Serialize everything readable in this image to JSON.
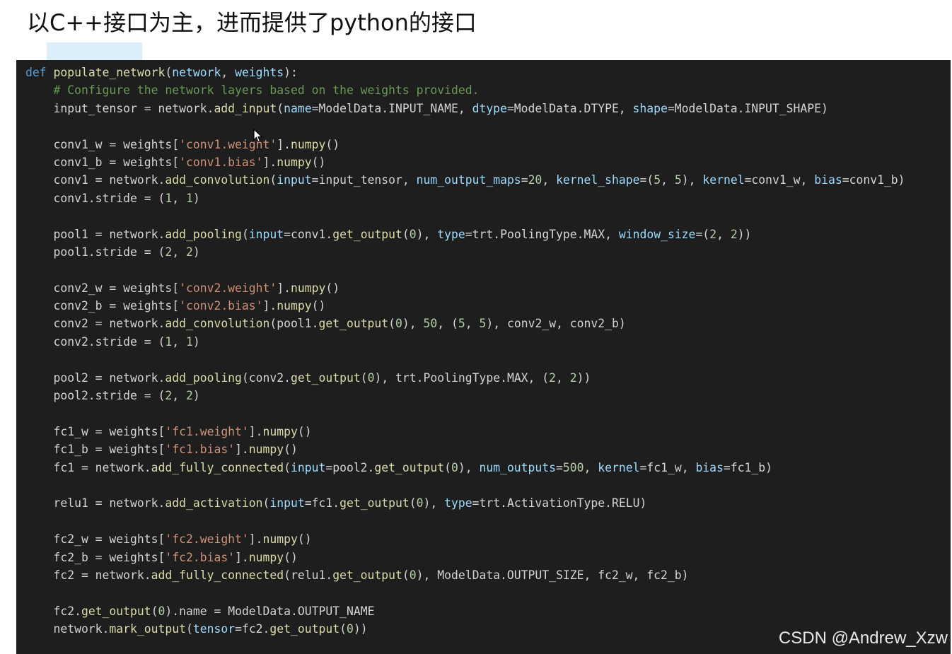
{
  "heading": {
    "text": "以C++接口为主，进而提供了python的接口"
  },
  "editor": {
    "colors": {
      "background": "#1e1e1e",
      "keyword": "#569cd6",
      "function": "#dcdcaa",
      "parameter": "#9cdcfe",
      "comment": "#6a9955",
      "string": "#ce9178",
      "number": "#b5cea8",
      "plain": "#d4d4d4"
    },
    "lines": [
      [
        [
          "kw",
          "def"
        ],
        [
          "pl",
          " "
        ],
        [
          "fn",
          "populate_network"
        ],
        [
          "pl",
          "("
        ],
        [
          "param",
          "network"
        ],
        [
          "pl",
          ", "
        ],
        [
          "param",
          "weights"
        ],
        [
          "pl",
          "):"
        ]
      ],
      [
        [
          "pl",
          "    "
        ],
        [
          "cm",
          "# Configure the network layers based on the weights provided."
        ]
      ],
      [
        [
          "pl",
          "    input_tensor = network."
        ],
        [
          "fn",
          "add_input"
        ],
        [
          "pl",
          "("
        ],
        [
          "param",
          "name"
        ],
        [
          "pl",
          "=ModelData.INPUT_NAME, "
        ],
        [
          "param",
          "dtype"
        ],
        [
          "pl",
          "=ModelData.DTYPE, "
        ],
        [
          "param",
          "shape"
        ],
        [
          "pl",
          "=ModelData.INPUT_SHAPE)"
        ]
      ],
      [],
      [
        [
          "pl",
          "    conv1_w = weights["
        ],
        [
          "str",
          "'conv1.weight'"
        ],
        [
          "pl",
          "]."
        ],
        [
          "fn",
          "numpy"
        ],
        [
          "pl",
          "()"
        ]
      ],
      [
        [
          "pl",
          "    conv1_b = weights["
        ],
        [
          "str",
          "'conv1.bias'"
        ],
        [
          "pl",
          "]."
        ],
        [
          "fn",
          "numpy"
        ],
        [
          "pl",
          "()"
        ]
      ],
      [
        [
          "pl",
          "    conv1 = network."
        ],
        [
          "fn",
          "add_convolution"
        ],
        [
          "pl",
          "("
        ],
        [
          "param",
          "input"
        ],
        [
          "pl",
          "=input_tensor, "
        ],
        [
          "param",
          "num_output_maps"
        ],
        [
          "pl",
          "="
        ],
        [
          "num",
          "20"
        ],
        [
          "pl",
          ", "
        ],
        [
          "param",
          "kernel_shape"
        ],
        [
          "pl",
          "=("
        ],
        [
          "num",
          "5"
        ],
        [
          "pl",
          ", "
        ],
        [
          "num",
          "5"
        ],
        [
          "pl",
          "), "
        ],
        [
          "param",
          "kernel"
        ],
        [
          "pl",
          "=conv1_w, "
        ],
        [
          "param",
          "bias"
        ],
        [
          "pl",
          "=conv1_b)"
        ]
      ],
      [
        [
          "pl",
          "    conv1.stride = ("
        ],
        [
          "num",
          "1"
        ],
        [
          "pl",
          ", "
        ],
        [
          "num",
          "1"
        ],
        [
          "pl",
          ")"
        ]
      ],
      [],
      [
        [
          "pl",
          "    pool1 = network."
        ],
        [
          "fn",
          "add_pooling"
        ],
        [
          "pl",
          "("
        ],
        [
          "param",
          "input"
        ],
        [
          "pl",
          "=conv1."
        ],
        [
          "fn",
          "get_output"
        ],
        [
          "pl",
          "("
        ],
        [
          "num",
          "0"
        ],
        [
          "pl",
          "), "
        ],
        [
          "param",
          "type"
        ],
        [
          "pl",
          "=trt.PoolingType.MAX, "
        ],
        [
          "param",
          "window_size"
        ],
        [
          "pl",
          "=("
        ],
        [
          "num",
          "2"
        ],
        [
          "pl",
          ", "
        ],
        [
          "num",
          "2"
        ],
        [
          "pl",
          "))"
        ]
      ],
      [
        [
          "pl",
          "    pool1.stride = ("
        ],
        [
          "num",
          "2"
        ],
        [
          "pl",
          ", "
        ],
        [
          "num",
          "2"
        ],
        [
          "pl",
          ")"
        ]
      ],
      [],
      [
        [
          "pl",
          "    conv2_w = weights["
        ],
        [
          "str",
          "'conv2.weight'"
        ],
        [
          "pl",
          "]."
        ],
        [
          "fn",
          "numpy"
        ],
        [
          "pl",
          "()"
        ]
      ],
      [
        [
          "pl",
          "    conv2_b = weights["
        ],
        [
          "str",
          "'conv2.bias'"
        ],
        [
          "pl",
          "]."
        ],
        [
          "fn",
          "numpy"
        ],
        [
          "pl",
          "()"
        ]
      ],
      [
        [
          "pl",
          "    conv2 = network."
        ],
        [
          "fn",
          "add_convolution"
        ],
        [
          "pl",
          "(pool1."
        ],
        [
          "fn",
          "get_output"
        ],
        [
          "pl",
          "("
        ],
        [
          "num",
          "0"
        ],
        [
          "pl",
          "), "
        ],
        [
          "num",
          "50"
        ],
        [
          "pl",
          ", ("
        ],
        [
          "num",
          "5"
        ],
        [
          "pl",
          ", "
        ],
        [
          "num",
          "5"
        ],
        [
          "pl",
          "), conv2_w, conv2_b)"
        ]
      ],
      [
        [
          "pl",
          "    conv2.stride = ("
        ],
        [
          "num",
          "1"
        ],
        [
          "pl",
          ", "
        ],
        [
          "num",
          "1"
        ],
        [
          "pl",
          ")"
        ]
      ],
      [],
      [
        [
          "pl",
          "    pool2 = network."
        ],
        [
          "fn",
          "add_pooling"
        ],
        [
          "pl",
          "(conv2."
        ],
        [
          "fn",
          "get_output"
        ],
        [
          "pl",
          "("
        ],
        [
          "num",
          "0"
        ],
        [
          "pl",
          "), trt.PoolingType.MAX, ("
        ],
        [
          "num",
          "2"
        ],
        [
          "pl",
          ", "
        ],
        [
          "num",
          "2"
        ],
        [
          "pl",
          "))"
        ]
      ],
      [
        [
          "pl",
          "    pool2.stride = ("
        ],
        [
          "num",
          "2"
        ],
        [
          "pl",
          ", "
        ],
        [
          "num",
          "2"
        ],
        [
          "pl",
          ")"
        ]
      ],
      [],
      [
        [
          "pl",
          "    fc1_w = weights["
        ],
        [
          "str",
          "'fc1.weight'"
        ],
        [
          "pl",
          "]."
        ],
        [
          "fn",
          "numpy"
        ],
        [
          "pl",
          "()"
        ]
      ],
      [
        [
          "pl",
          "    fc1_b = weights["
        ],
        [
          "str",
          "'fc1.bias'"
        ],
        [
          "pl",
          "]."
        ],
        [
          "fn",
          "numpy"
        ],
        [
          "pl",
          "()"
        ]
      ],
      [
        [
          "pl",
          "    fc1 = network."
        ],
        [
          "fn",
          "add_fully_connected"
        ],
        [
          "pl",
          "("
        ],
        [
          "param",
          "input"
        ],
        [
          "pl",
          "=pool2."
        ],
        [
          "fn",
          "get_output"
        ],
        [
          "pl",
          "("
        ],
        [
          "num",
          "0"
        ],
        [
          "pl",
          "), "
        ],
        [
          "param",
          "num_outputs"
        ],
        [
          "pl",
          "="
        ],
        [
          "num",
          "500"
        ],
        [
          "pl",
          ", "
        ],
        [
          "param",
          "kernel"
        ],
        [
          "pl",
          "=fc1_w, "
        ],
        [
          "param",
          "bias"
        ],
        [
          "pl",
          "=fc1_b)"
        ]
      ],
      [],
      [
        [
          "pl",
          "    relu1 = network."
        ],
        [
          "fn",
          "add_activation"
        ],
        [
          "pl",
          "("
        ],
        [
          "param",
          "input"
        ],
        [
          "pl",
          "=fc1."
        ],
        [
          "fn",
          "get_output"
        ],
        [
          "pl",
          "("
        ],
        [
          "num",
          "0"
        ],
        [
          "pl",
          "), "
        ],
        [
          "param",
          "type"
        ],
        [
          "pl",
          "=trt.ActivationType.RELU)"
        ]
      ],
      [],
      [
        [
          "pl",
          "    fc2_w = weights["
        ],
        [
          "str",
          "'fc2.weight'"
        ],
        [
          "pl",
          "]."
        ],
        [
          "fn",
          "numpy"
        ],
        [
          "pl",
          "()"
        ]
      ],
      [
        [
          "pl",
          "    fc2_b = weights["
        ],
        [
          "str",
          "'fc2.bias'"
        ],
        [
          "pl",
          "]."
        ],
        [
          "fn",
          "numpy"
        ],
        [
          "pl",
          "()"
        ]
      ],
      [
        [
          "pl",
          "    fc2 = network."
        ],
        [
          "fn",
          "add_fully_connected"
        ],
        [
          "pl",
          "(relu1."
        ],
        [
          "fn",
          "get_output"
        ],
        [
          "pl",
          "("
        ],
        [
          "num",
          "0"
        ],
        [
          "pl",
          "), ModelData.OUTPUT_SIZE, fc2_w, fc2_b)"
        ]
      ],
      [],
      [
        [
          "pl",
          "    fc2."
        ],
        [
          "fn",
          "get_output"
        ],
        [
          "pl",
          "("
        ],
        [
          "num",
          "0"
        ],
        [
          "pl",
          ").name = ModelData.OUTPUT_NAME"
        ]
      ],
      [
        [
          "pl",
          "    network."
        ],
        [
          "fn",
          "mark_output"
        ],
        [
          "pl",
          "("
        ],
        [
          "param",
          "tensor"
        ],
        [
          "pl",
          "=fc2."
        ],
        [
          "fn",
          "get_output"
        ],
        [
          "pl",
          "("
        ],
        [
          "num",
          "0"
        ],
        [
          "pl",
          "))"
        ]
      ]
    ]
  },
  "watermark": {
    "text": "CSDN @Andrew_Xzw"
  },
  "cursor": {
    "icon": "mouse-pointer-icon"
  }
}
